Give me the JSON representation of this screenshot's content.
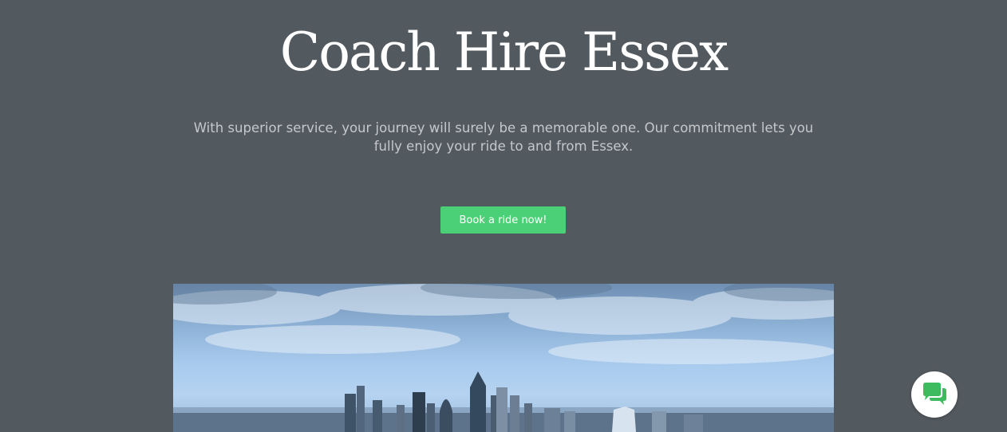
{
  "hero": {
    "title": "Coach Hire Essex",
    "subtitle": "With superior service, your journey will surely be a memorable one. Our commitment lets you fully enjoy your ride to and from Essex.",
    "cta_label": "Book a ride now!"
  },
  "image": {
    "subject": "london-skyline"
  },
  "chat": {
    "icon": "chat-bubbles-icon"
  },
  "colors": {
    "background": "#535a5f",
    "title_text": "#ffffff",
    "subtitle_text": "#c4c8cb",
    "cta_background": "#4cd077",
    "chat_icon": "#3dbb5e"
  }
}
